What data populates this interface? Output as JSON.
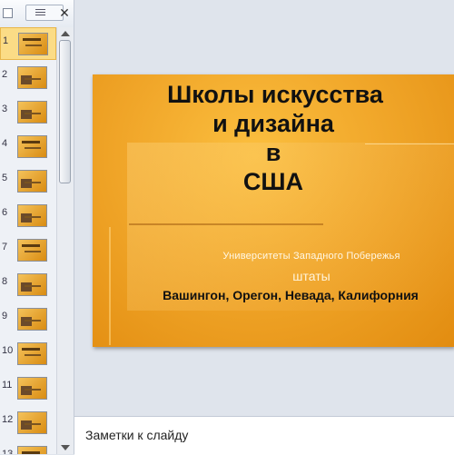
{
  "sidebar": {
    "close_glyph": "✕",
    "thumbnails": [
      {
        "number": "1",
        "selected": true
      },
      {
        "number": "2",
        "selected": false
      },
      {
        "number": "3",
        "selected": false
      },
      {
        "number": "4",
        "selected": false
      },
      {
        "number": "5",
        "selected": false
      },
      {
        "number": "6",
        "selected": false
      },
      {
        "number": "7",
        "selected": false
      },
      {
        "number": "8",
        "selected": false
      },
      {
        "number": "9",
        "selected": false
      },
      {
        "number": "10",
        "selected": false
      },
      {
        "number": "11",
        "selected": false
      },
      {
        "number": "12",
        "selected": false
      },
      {
        "number": "13",
        "selected": false
      }
    ]
  },
  "slide": {
    "title_line1": "Школы искусства",
    "title_line2": "и дизайна",
    "title_line3": "в",
    "title_line4": "США",
    "subtitle_universities": "Университеты   Западного  Побережья",
    "subtitle_states": "штаты",
    "subtitle_state_list": "Вашингон, Орегон, Невада, Калифорния",
    "background_color": "#f1a72a"
  },
  "notes": {
    "placeholder": "Заметки к слайду"
  },
  "colors": {
    "selected_thumbnail": "#fbdc86",
    "pane_background": "#eef1f6"
  }
}
